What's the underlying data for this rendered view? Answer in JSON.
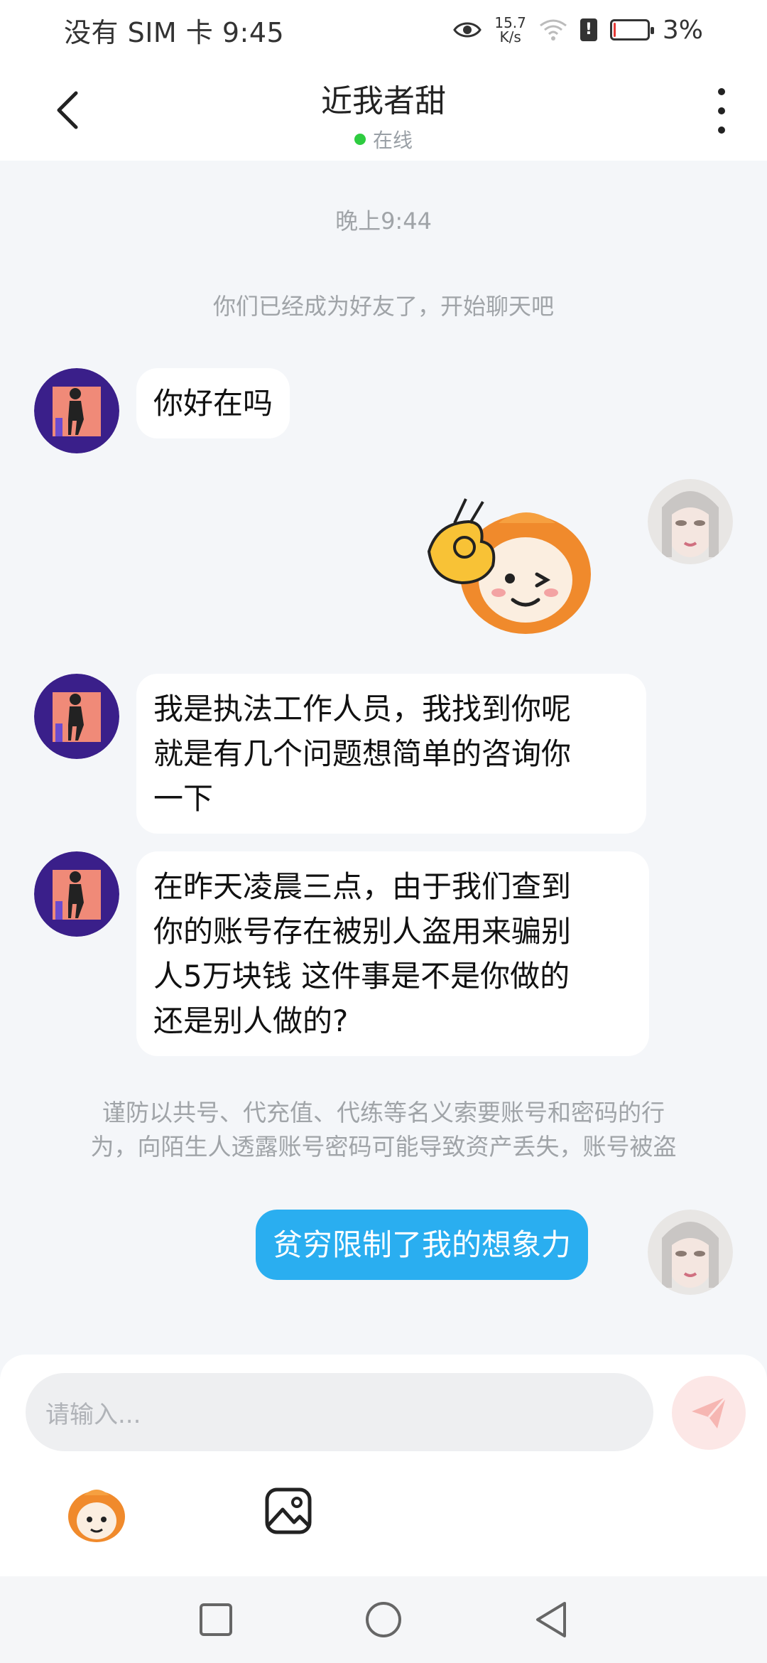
{
  "status_bar": {
    "carrier_time": "没有 SIM 卡 9:45",
    "speed_value": "15.7",
    "speed_unit": "K/s",
    "battery": "3%"
  },
  "header": {
    "title": "近我者甜",
    "status": "在线",
    "status_color": "#2ecc40"
  },
  "chat": {
    "time_label": "晚上9:44",
    "system_note": "你们已经成为好友了，开始聊天吧",
    "messages": [
      {
        "sender": "other",
        "lines": [
          "你好在吗"
        ]
      },
      {
        "sender": "self",
        "type": "sticker",
        "icon": "ok-gesture-mascot-sticker"
      },
      {
        "sender": "other",
        "lines": [
          "我是执法工作人员，我找到你呢",
          "就是有几个问题想简单的咨询你",
          "一下"
        ]
      },
      {
        "sender": "other",
        "lines": [
          "在昨天凌晨三点，由于我们查到",
          "你的账号存在被别人盗用来骗别",
          "人5万块钱 这件事是不是你做的",
          "还是别人做的?"
        ]
      },
      {
        "sender": "self",
        "lines": [
          "贫穷限制了我的想象力"
        ]
      }
    ],
    "warning_lines": [
      "谨防以共号、代充值、代练等名义索要账号和密码的行",
      "为，向陌生人透露账号密码可能导致资产丢失，账号被盗"
    ]
  },
  "input": {
    "placeholder": "请输入..."
  },
  "colors": {
    "self_bubble": "#2aaef0",
    "chat_background": "#f4f6f9",
    "send_button": "#fce7e6"
  },
  "icons": {
    "back": "chevron-left-icon",
    "more": "more-vertical-icon",
    "send": "send-icon",
    "sticker_tool": "sticker-icon",
    "image_tool": "image-icon",
    "nav_recent": "square-icon",
    "nav_home": "circle-icon",
    "nav_back": "triangle-back-icon"
  }
}
